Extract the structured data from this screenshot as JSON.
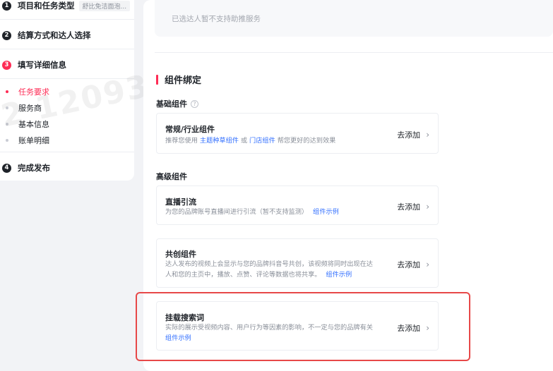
{
  "sidebar": {
    "steps": [
      {
        "num": "1",
        "label": "项目和任务类型",
        "tag": "舒比免洁面泡..."
      },
      {
        "num": "2",
        "label": "结算方式和达人选择"
      },
      {
        "num": "3",
        "label": "填写详细信息"
      },
      {
        "num": "4",
        "label": "完成发布"
      }
    ],
    "substeps": [
      {
        "label": "任务要求"
      },
      {
        "label": "服务商"
      },
      {
        "label": "基本信息"
      },
      {
        "label": "账单明细"
      }
    ],
    "watermark": "2 12093"
  },
  "main": {
    "notice": "已选达人暂不支持助推服务",
    "section_title": "组件绑定",
    "basic_group": {
      "title": "基础组件",
      "help_icon": "question-circle-icon"
    },
    "advanced_group": {
      "title": "高级组件"
    },
    "cards": {
      "general": {
        "title": "常规/行业组件",
        "desc_prefix": "推荐您使用",
        "link1": "主题种草组件",
        "desc_mid": "或",
        "link2": "门店组件",
        "desc_suffix": "帮您更好的达到效果",
        "action": "去添加"
      },
      "live": {
        "title": "直播引流",
        "desc": "为您的品牌账号直播间进行引流（暂不支持监测）",
        "link": "组件示例",
        "action": "去添加"
      },
      "cocreate": {
        "title": "共创组件",
        "desc_line1": "达人发布的视频上会显示与您的品牌抖音号共创，该视频将同时出现在达",
        "desc_line2": "人和您的主页中，播放、点赞、评论等数据也将共享。",
        "link": "组件示例",
        "action": "去添加"
      },
      "search": {
        "title": "挂载搜索词",
        "desc": "实际的展示受视频内容、用户行为等因素的影响，不一定与您的品牌有关",
        "link": "组件示例",
        "action": "去添加"
      }
    }
  },
  "colors": {
    "accent": "#fe2c55",
    "link": "#3370ff",
    "highlight": "#e74848"
  },
  "icons": {
    "chevron": "chevron-right-icon",
    "help": "question-circle-icon"
  }
}
